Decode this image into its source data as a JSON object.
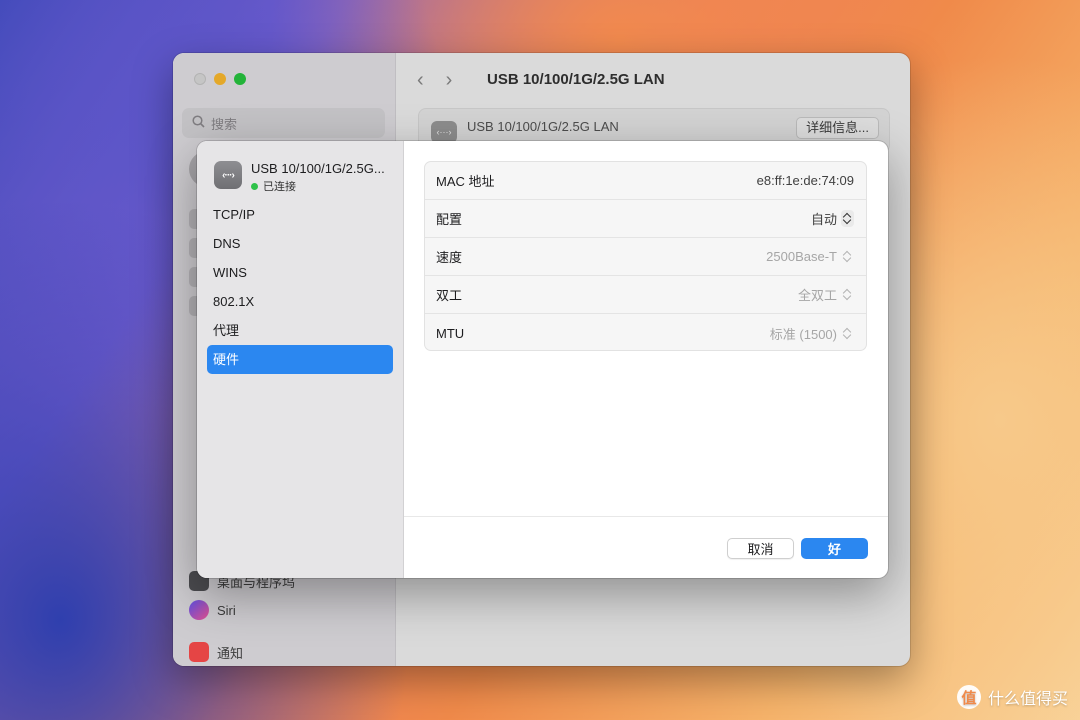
{
  "background_window": {
    "search_placeholder": "搜索",
    "sidebar_rows": [
      {
        "label": "桌面与程序坞"
      },
      {
        "label": "Siri"
      },
      {
        "label": "通知"
      }
    ],
    "title": "USB 10/100/1G/2.5G LAN",
    "card": {
      "name": "USB 10/100/1G/2.5G LAN",
      "details_button": "详细信息..."
    }
  },
  "sheet": {
    "interface": {
      "name": "USB 10/100/1G/2.5G...",
      "status": "已连接",
      "icon": "ethernet-icon"
    },
    "menu": [
      {
        "label": "TCP/IP",
        "active": false
      },
      {
        "label": "DNS",
        "active": false
      },
      {
        "label": "WINS",
        "active": false
      },
      {
        "label": "802.1X",
        "active": false
      },
      {
        "label": "代理",
        "active": false
      },
      {
        "label": "硬件",
        "active": true
      }
    ],
    "hardware": {
      "mac": {
        "label": "MAC 地址",
        "value": "e8:ff:1e:de:74:09"
      },
      "config": {
        "label": "配置",
        "value": "自动"
      },
      "speed": {
        "label": "速度",
        "value": "2500Base-T"
      },
      "duplex": {
        "label": "双工",
        "value": "全双工"
      },
      "mtu": {
        "label": "MTU",
        "value": "标准 (1500)"
      }
    },
    "buttons": {
      "cancel": "取消",
      "ok": "好"
    }
  },
  "watermark": {
    "badge": "值",
    "text": "什么值得买"
  },
  "colors": {
    "accent": "#2b87f0",
    "connected": "#2fc24a"
  }
}
